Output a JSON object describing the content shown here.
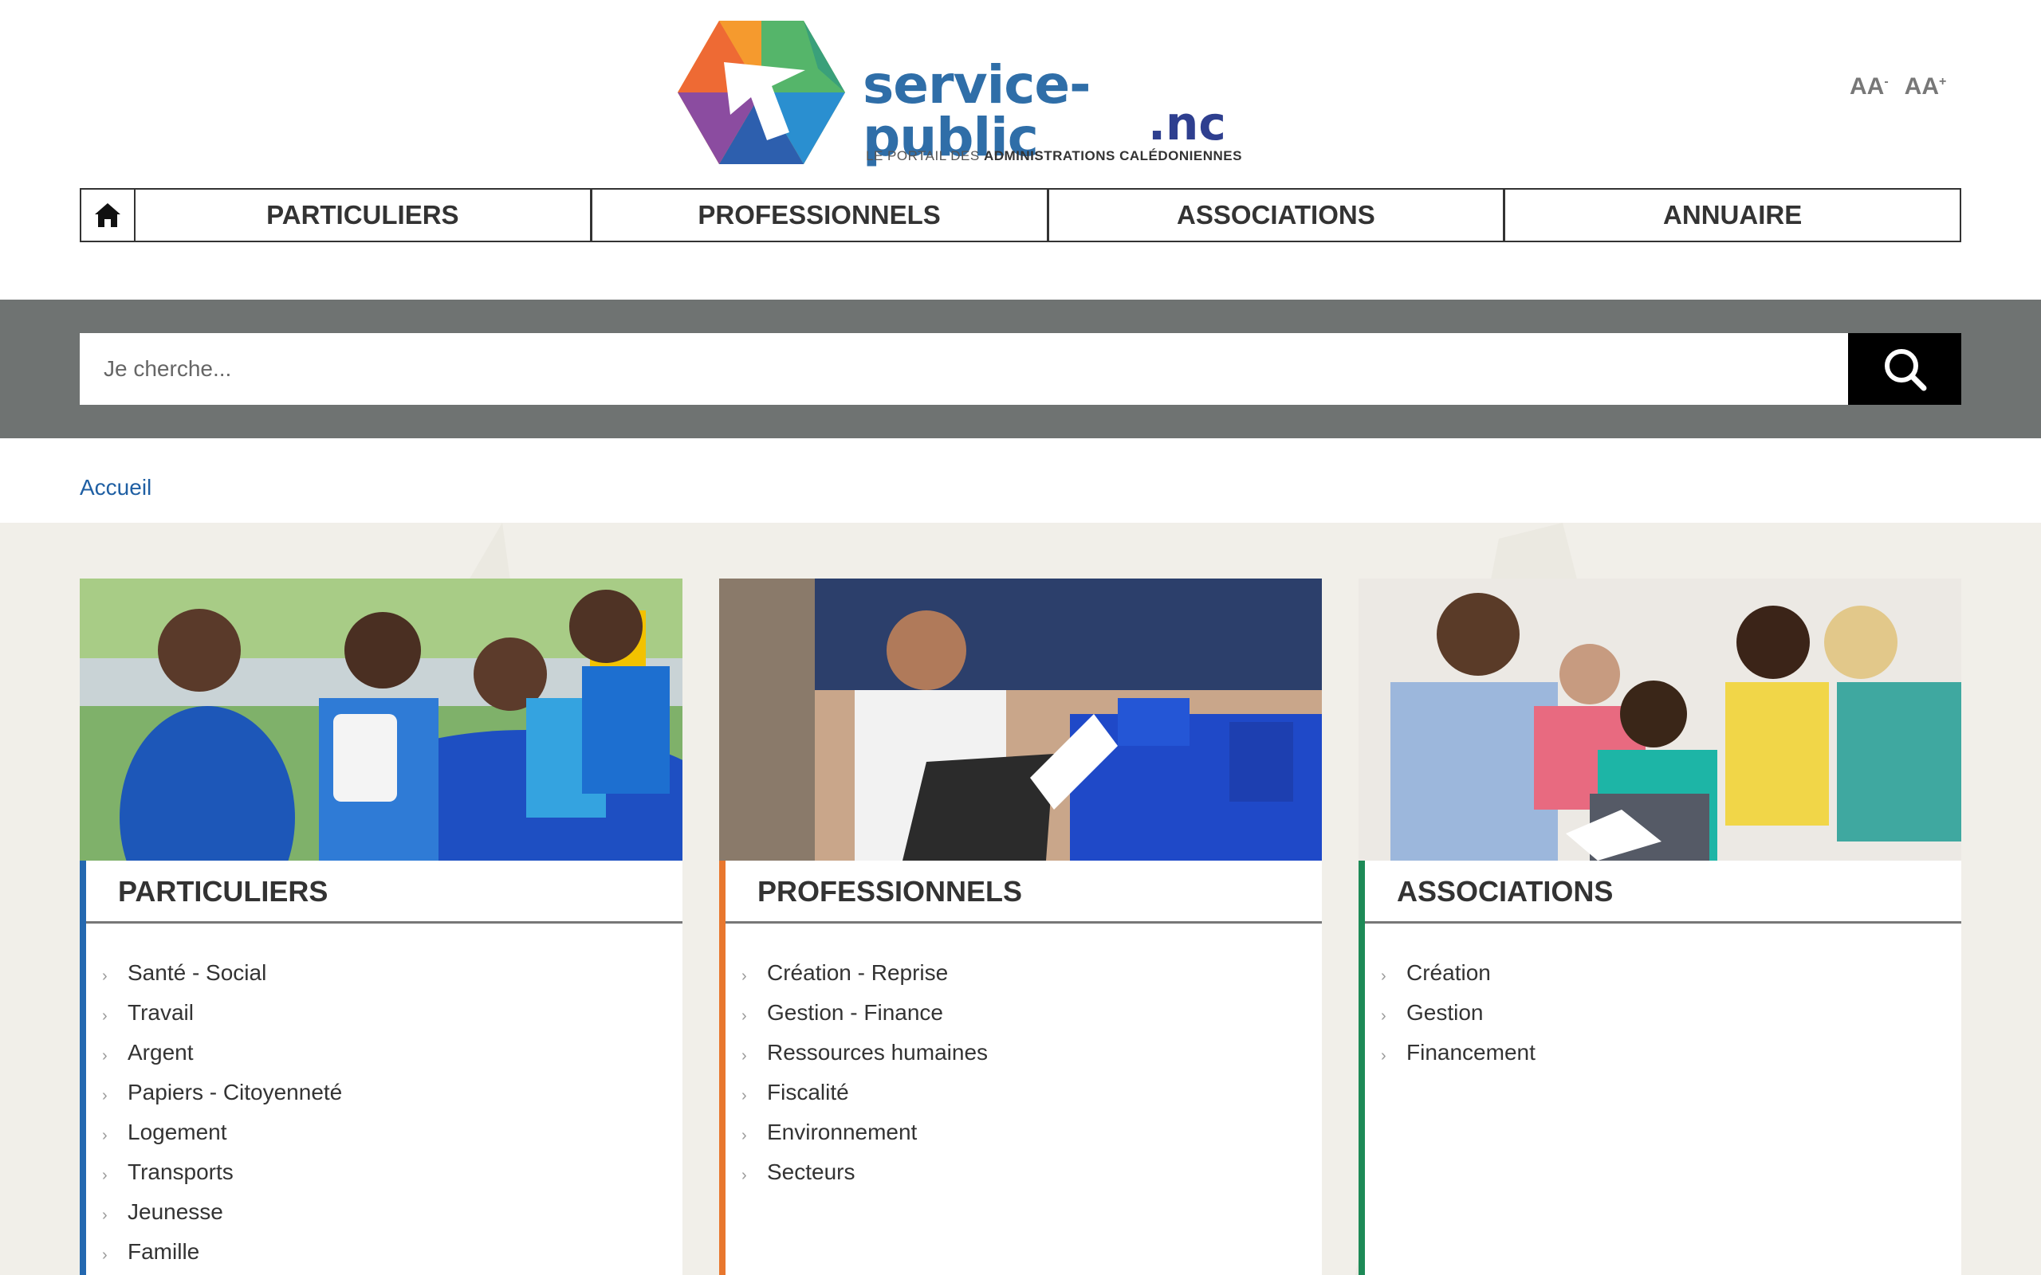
{
  "header": {
    "logo": {
      "word": "service-public",
      "suffix": ".nc",
      "tagline_prefix": "LE PORTAIL DES ",
      "tagline_bold": "ADMINISTRATIONS CALÉDONIENNES"
    },
    "font_controls": {
      "decrease_label": "AA",
      "decrease_sup": "-",
      "increase_label": "AA",
      "increase_sup": "+"
    }
  },
  "nav": {
    "home_icon": "home-icon",
    "items": [
      {
        "label": "PARTICULIERS"
      },
      {
        "label": "PROFESSIONNELS"
      },
      {
        "label": "ASSOCIATIONS"
      },
      {
        "label": "ANNUAIRE"
      }
    ]
  },
  "search": {
    "placeholder": "Je cherche...",
    "icon": "search-icon"
  },
  "breadcrumb": {
    "items": [
      "Accueil"
    ]
  },
  "colors": {
    "particuliers": "#2468b0",
    "professionnels": "#e8772e",
    "associations": "#1d8a57",
    "search_band": "#6f7372",
    "main_bg": "#f1efe9"
  },
  "cards": [
    {
      "title": "PARTICULIERS",
      "items": [
        "Santé - Social",
        "Travail",
        "Argent",
        "Papiers - Citoyenneté",
        "Logement",
        "Transports",
        "Jeunesse",
        "Famille"
      ]
    },
    {
      "title": "PROFESSIONNELS",
      "items": [
        "Création - Reprise",
        "Gestion - Finance",
        "Ressources humaines",
        "Fiscalité",
        "Environnement",
        "Secteurs"
      ]
    },
    {
      "title": "ASSOCIATIONS",
      "items": [
        "Création",
        "Gestion",
        "Financement"
      ]
    }
  ]
}
